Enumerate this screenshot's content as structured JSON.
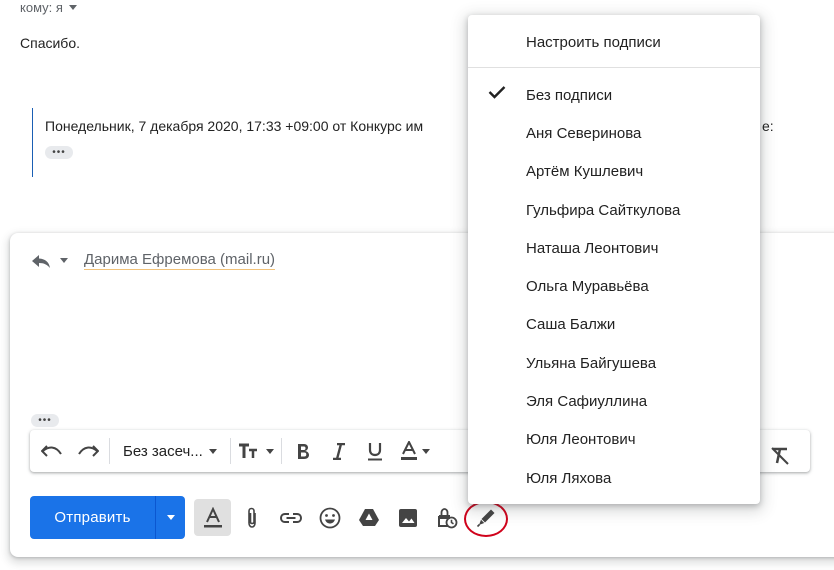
{
  "message": {
    "to_label": "кому: я",
    "body": "Спасибо.",
    "quote_header": "Понедельник, 7 декабря 2020, 17:33 +09:00 от Конкурс им",
    "quote_tail": "e:",
    "quote_dots": "•••"
  },
  "compose": {
    "recipient": "Дарима Ефремова (mail.ru)",
    "dots": "•••"
  },
  "toolbar": {
    "font_name": "Без засеч...",
    "items": [
      "undo-icon",
      "redo-icon",
      "font-size-icon",
      "bold-icon",
      "italic-icon",
      "underline-icon",
      "text-color-icon",
      "remove-formatting-icon"
    ]
  },
  "bottom": {
    "send_label": "Отправить",
    "tools": [
      "formatting-icon",
      "attach-icon",
      "link-icon",
      "emoji-icon",
      "drive-icon",
      "photo-icon",
      "confidential-icon",
      "signature-pen-icon"
    ]
  },
  "signature_menu": {
    "header": "Настроить подписи",
    "selected": "Без подписи",
    "items": [
      "Без подписи",
      "Аня Северинова",
      "Артём Кушлевич",
      "Гульфира Сайткулова",
      "Наташа Леонтович",
      "Ольга Муравьёва",
      "Саша Балжи",
      "Ульяна Байгушева",
      "Эля Сафиуллина",
      "Юля Леонтович",
      "Юля Ляхова"
    ]
  },
  "colors": {
    "accent": "#1a73e8",
    "highlight_ring": "#d0021b",
    "quote_bar": "#1a5fb4"
  }
}
